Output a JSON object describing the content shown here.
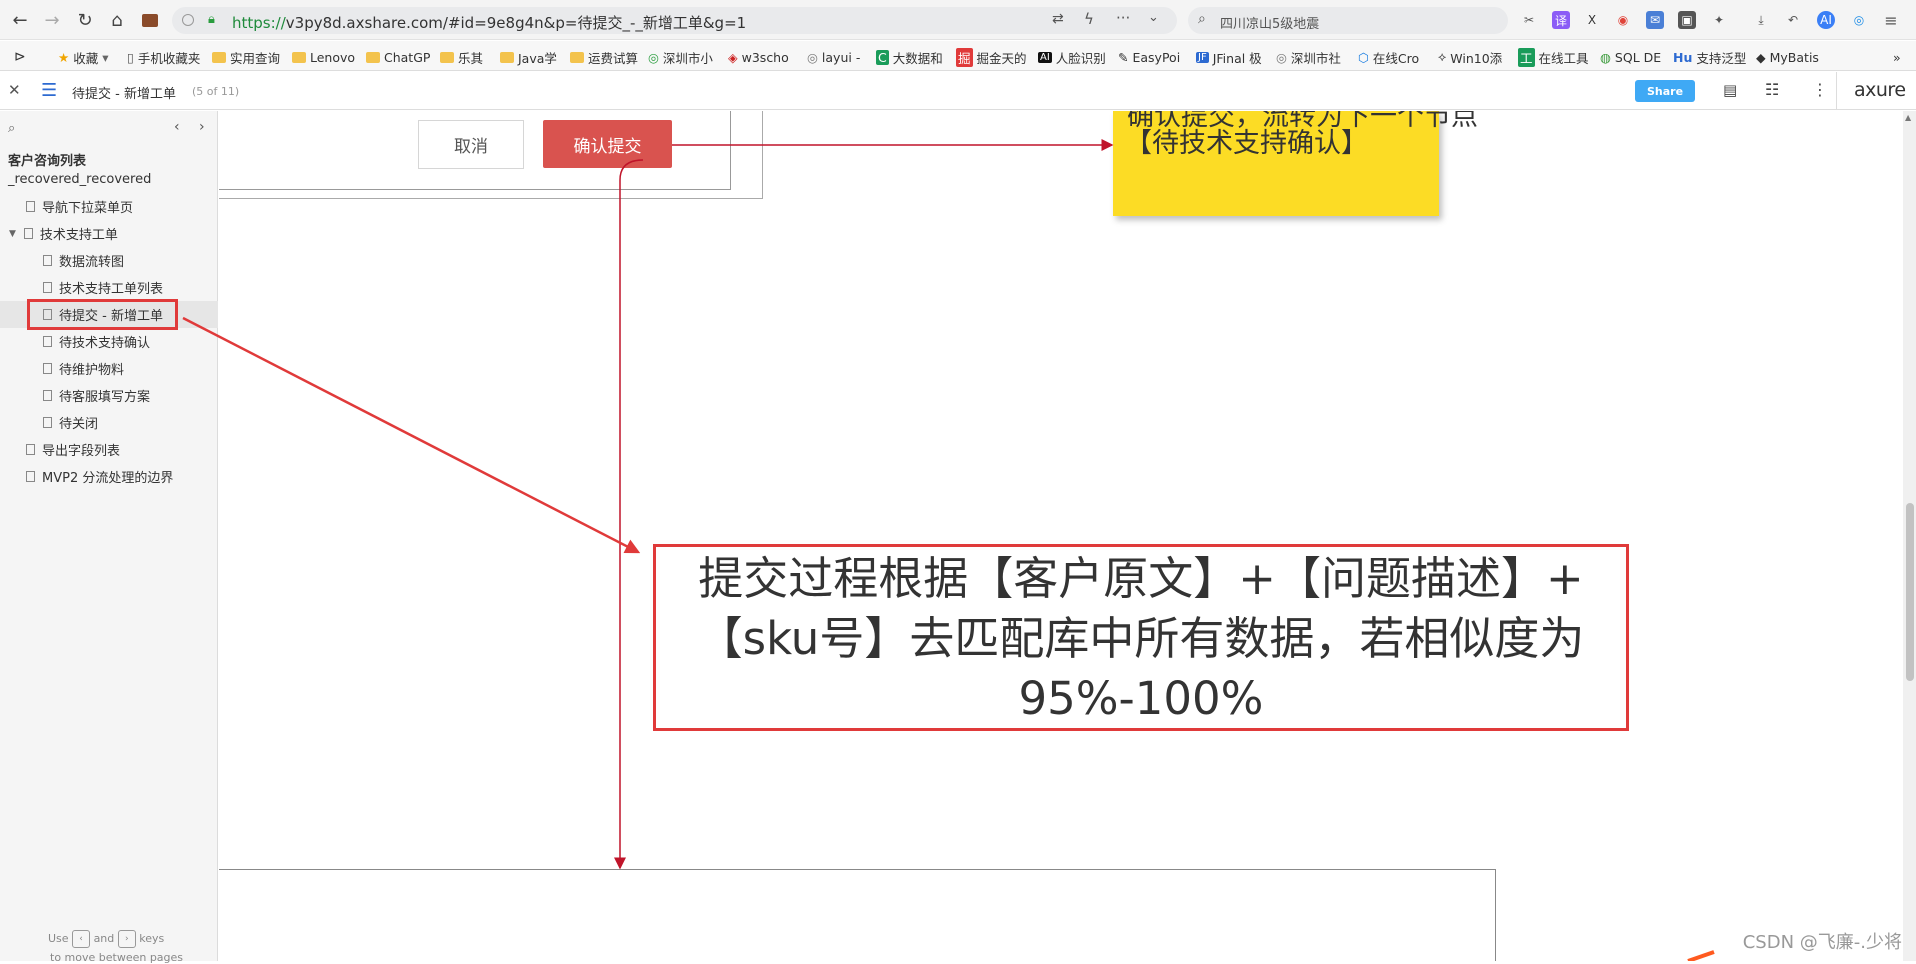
{
  "browser": {
    "url_https": "https://",
    "url_rest": "v3py8d.axshare.com/#id=9e8g4n&p=待提交_-_新增工单&g=1",
    "search": "四川凉山5级地震"
  },
  "bookmarks": [
    "收藏",
    "手机收藏夹",
    "实用查询",
    "Lenovo",
    "ChatGP",
    "乐其",
    "Java学",
    "运费试算",
    "深圳市小",
    "w3scho",
    "layui -",
    "大数据和",
    "掘金天的",
    "人脸识别",
    "EasyPoi",
    "JFinal 极",
    "深圳市社",
    "在线Cro",
    "Win10添",
    "在线工具",
    "SQL DE",
    "支持泛型",
    "MyBatis"
  ],
  "axure": {
    "page_title": "待提交 - 新增工单",
    "page_count": "(5 of 11)",
    "share_label": "Share",
    "logo": "axure"
  },
  "sidebar": {
    "project_title": "客户咨询列表",
    "project_sub": "_recovered_recovered",
    "items": [
      {
        "label": "导航下拉菜单页",
        "level": 1
      },
      {
        "label": "技术支持工单",
        "level": 1
      },
      {
        "label": "数据流转图",
        "level": 2
      },
      {
        "label": "技术支持工单列表",
        "level": 2
      },
      {
        "label": "待提交 - 新增工单",
        "level": 2
      },
      {
        "label": "待技术支持确认",
        "level": 2
      },
      {
        "label": "待维护物料",
        "level": 2
      },
      {
        "label": "待客服填写方案",
        "level": 2
      },
      {
        "label": "待关闭",
        "level": 2
      },
      {
        "label": "导出字段列表",
        "level": 1
      },
      {
        "label": "MVP2 分流处理的边界",
        "level": 1
      }
    ],
    "hint_use": "Use",
    "hint_and": "and",
    "hint_keys": "keys",
    "hint_line2": "to move between pages"
  },
  "canvas": {
    "cancel_label": "取消",
    "confirm_label": "确认提交",
    "sticky_line1": "确认提交，流转为下一个节点",
    "sticky_line2": "【待技术支持确认】",
    "callout_line1": "提交过程根据【客户原文】+【问题描述】+",
    "callout_line2": "【sku号】去匹配库中所有数据，若相似度为",
    "callout_line3": "95%-100%",
    "watermark": "CSDN @飞廉-.少将"
  },
  "colors": {
    "accent_red": "#d9534f",
    "annotation_red": "#e03a3a",
    "sticky_yellow": "#fcdc25",
    "share_blue": "#3fa9f5"
  }
}
